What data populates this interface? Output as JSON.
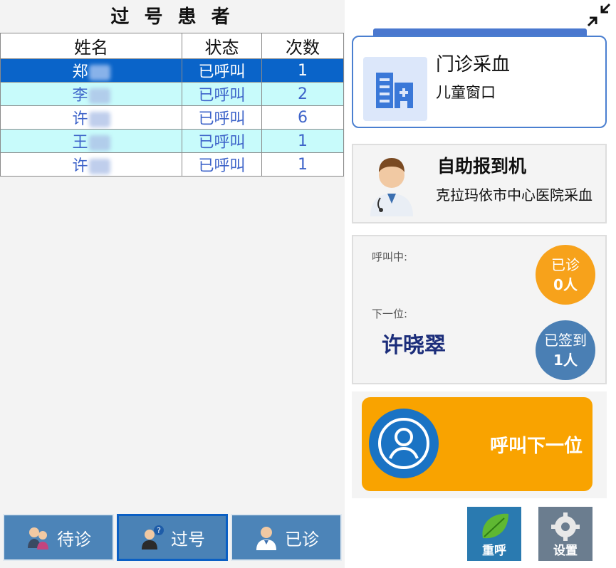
{
  "left": {
    "title": "过 号 患 者",
    "columns": [
      "姓名",
      "状态",
      "次数"
    ],
    "rows": [
      {
        "name": "郑",
        "status": "已呼叫",
        "count": "1"
      },
      {
        "name": "李",
        "status": "已呼叫",
        "count": "2"
      },
      {
        "name": "许",
        "status": "已呼叫",
        "count": "6"
      },
      {
        "name": "王",
        "status": "已呼叫",
        "count": "1"
      },
      {
        "name": "许",
        "status": "已呼叫",
        "count": "1"
      }
    ],
    "tabs": [
      {
        "label": "待诊",
        "icon": "patients-icon"
      },
      {
        "label": "过号",
        "icon": "missed-patient-icon"
      },
      {
        "label": "已诊",
        "icon": "doctor-icon"
      }
    ]
  },
  "right": {
    "department": "门诊采血",
    "window": "儿童窗口",
    "station_title": "自助报到机",
    "station_subtitle": "克拉玛依市中心医院采血",
    "calling_label": "呼叫中:",
    "next_label": "下一位:",
    "next_patient": "许晓翠",
    "seen_label": "已诊",
    "seen_count": "0人",
    "checked_in_label": "已签到",
    "checked_in_count": "1人",
    "call_next": "呼叫下一位",
    "recall": "重呼",
    "settings": "设置"
  },
  "colors": {
    "selected_row": "#0a64c9",
    "alt_row": "#c8fbfb",
    "tab_blue": "#4c84b8",
    "call_orange": "#f9a300",
    "badge_orange": "#f7a21b",
    "badge_blue": "#4a7fb4"
  }
}
